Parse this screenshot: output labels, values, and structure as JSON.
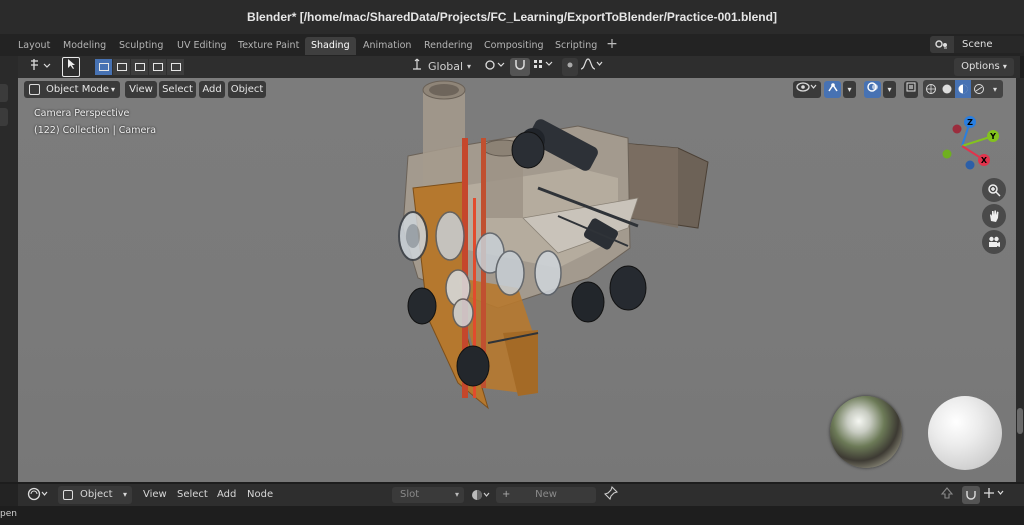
{
  "window": {
    "title": "Blender* [/home/mac/SharedData/Projects/FC_Learning/ExportToBlender/Practice-001.blend]"
  },
  "workspaces": {
    "tabs": [
      {
        "label": "Layout"
      },
      {
        "label": "Modeling"
      },
      {
        "label": "Sculpting"
      },
      {
        "label": "UV Editing"
      },
      {
        "label": "Texture Paint"
      },
      {
        "label": "Shading"
      },
      {
        "label": "Animation"
      },
      {
        "label": "Rendering"
      },
      {
        "label": "Compositing"
      },
      {
        "label": "Scripting"
      }
    ],
    "active": "Shading",
    "add": "+"
  },
  "scene": {
    "label": "Scene"
  },
  "header": {
    "transform_orientation": "Global",
    "options": "Options"
  },
  "viewport": {
    "mode": "Object Mode",
    "menus": [
      "View",
      "Select",
      "Add",
      "Object"
    ],
    "info_line1": "Camera Perspective",
    "info_line2": "(122) Collection | Camera",
    "gizmo": {
      "x": "X",
      "y": "Y",
      "z": "Z"
    },
    "shading_active": "material-preview",
    "colors": {
      "x": "#e0344d",
      "y": "#83c21e",
      "z": "#2a7fe0",
      "accent": "#4772b3"
    }
  },
  "bottom_editor": {
    "mode": "Object",
    "menus": [
      "View",
      "Select",
      "Add",
      "Node"
    ],
    "slot": "Slot",
    "new": "New"
  },
  "statusbar": {
    "left_text": "pen"
  }
}
